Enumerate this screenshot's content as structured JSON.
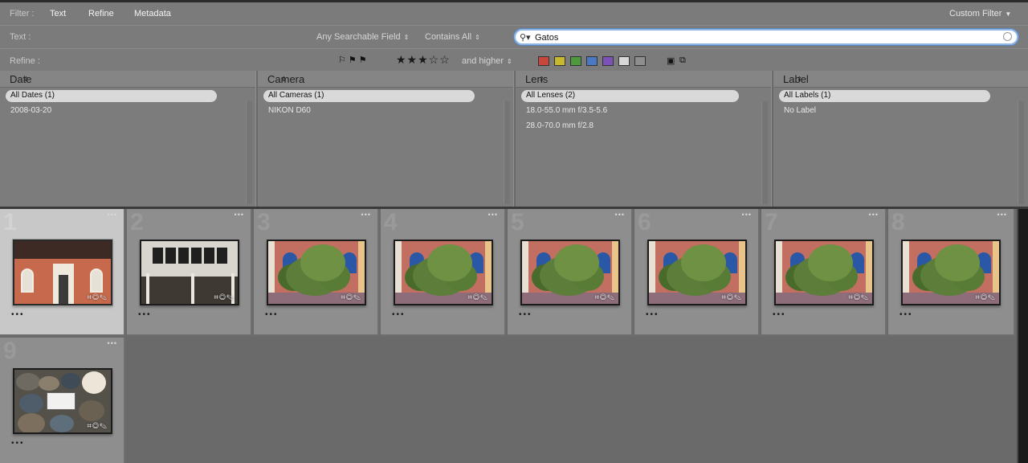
{
  "filter_bar": {
    "filter_label": "Filter :",
    "tabs": [
      "Text",
      "Refine",
      "Metadata"
    ],
    "custom_filter": "Custom Filter",
    "text_row": {
      "label": "Text :",
      "field_dropdown": "Any Searchable Field",
      "rule_dropdown": "Contains All",
      "search_value": "Gatos"
    },
    "refine_row": {
      "label": "Refine :",
      "rating_stars": "★★★☆☆",
      "rating_value": 3,
      "rating_dropdown": "and higher",
      "color_labels": [
        "#c9463c",
        "#c8b82e",
        "#4c9a3d",
        "#4b78c2",
        "#7c52b8",
        "#d8d8d8",
        "#8e8e8e"
      ]
    }
  },
  "metadata_browser": {
    "columns": [
      {
        "header": "Date",
        "all_label": "All Dates (1)",
        "items": [
          {
            "label": "2008-03-20",
            "count": ""
          }
        ]
      },
      {
        "header": "Camera",
        "all_label": "All Cameras (1)",
        "items": [
          {
            "label": "NIKON D60",
            "count": ""
          }
        ]
      },
      {
        "header": "Lens",
        "all_label": "All Lenses (2)",
        "items": [
          {
            "label": "18.0-55.0 mm f/3.5-5.6",
            "count": ""
          },
          {
            "label": "28.0-70.0 mm f/2.8",
            "count": ""
          }
        ]
      },
      {
        "header": "Label",
        "all_label": "All Labels (1)",
        "items": [
          {
            "label": "No Label",
            "count": ""
          }
        ]
      }
    ]
  },
  "grid": {
    "thumbnails": [
      {
        "index": "1",
        "subject": "building",
        "selected": true,
        "rating_dots": "•••",
        "more": "•••"
      },
      {
        "index": "2",
        "subject": "shop",
        "selected": false,
        "rating_dots": "•••",
        "more": "•••"
      },
      {
        "index": "3",
        "subject": "cactus",
        "selected": false,
        "rating_dots": "•••",
        "more": "•••"
      },
      {
        "index": "4",
        "subject": "cactus",
        "selected": false,
        "rating_dots": "•••",
        "more": "•••"
      },
      {
        "index": "5",
        "subject": "cactus",
        "selected": false,
        "rating_dots": "•••",
        "more": "•••"
      },
      {
        "index": "6",
        "subject": "cactus",
        "selected": false,
        "rating_dots": "•••",
        "more": "•••"
      },
      {
        "index": "7",
        "subject": "cactus",
        "selected": false,
        "rating_dots": "•••",
        "more": "•••"
      },
      {
        "index": "8",
        "subject": "cactus",
        "selected": false,
        "rating_dots": "•••",
        "more": "•••"
      },
      {
        "index": "9",
        "subject": "rocks",
        "selected": false,
        "rating_dots": "•••",
        "more": "•••"
      }
    ],
    "badge_icons": [
      "crop-icon",
      "metadata-icon",
      "develop-icon"
    ]
  }
}
